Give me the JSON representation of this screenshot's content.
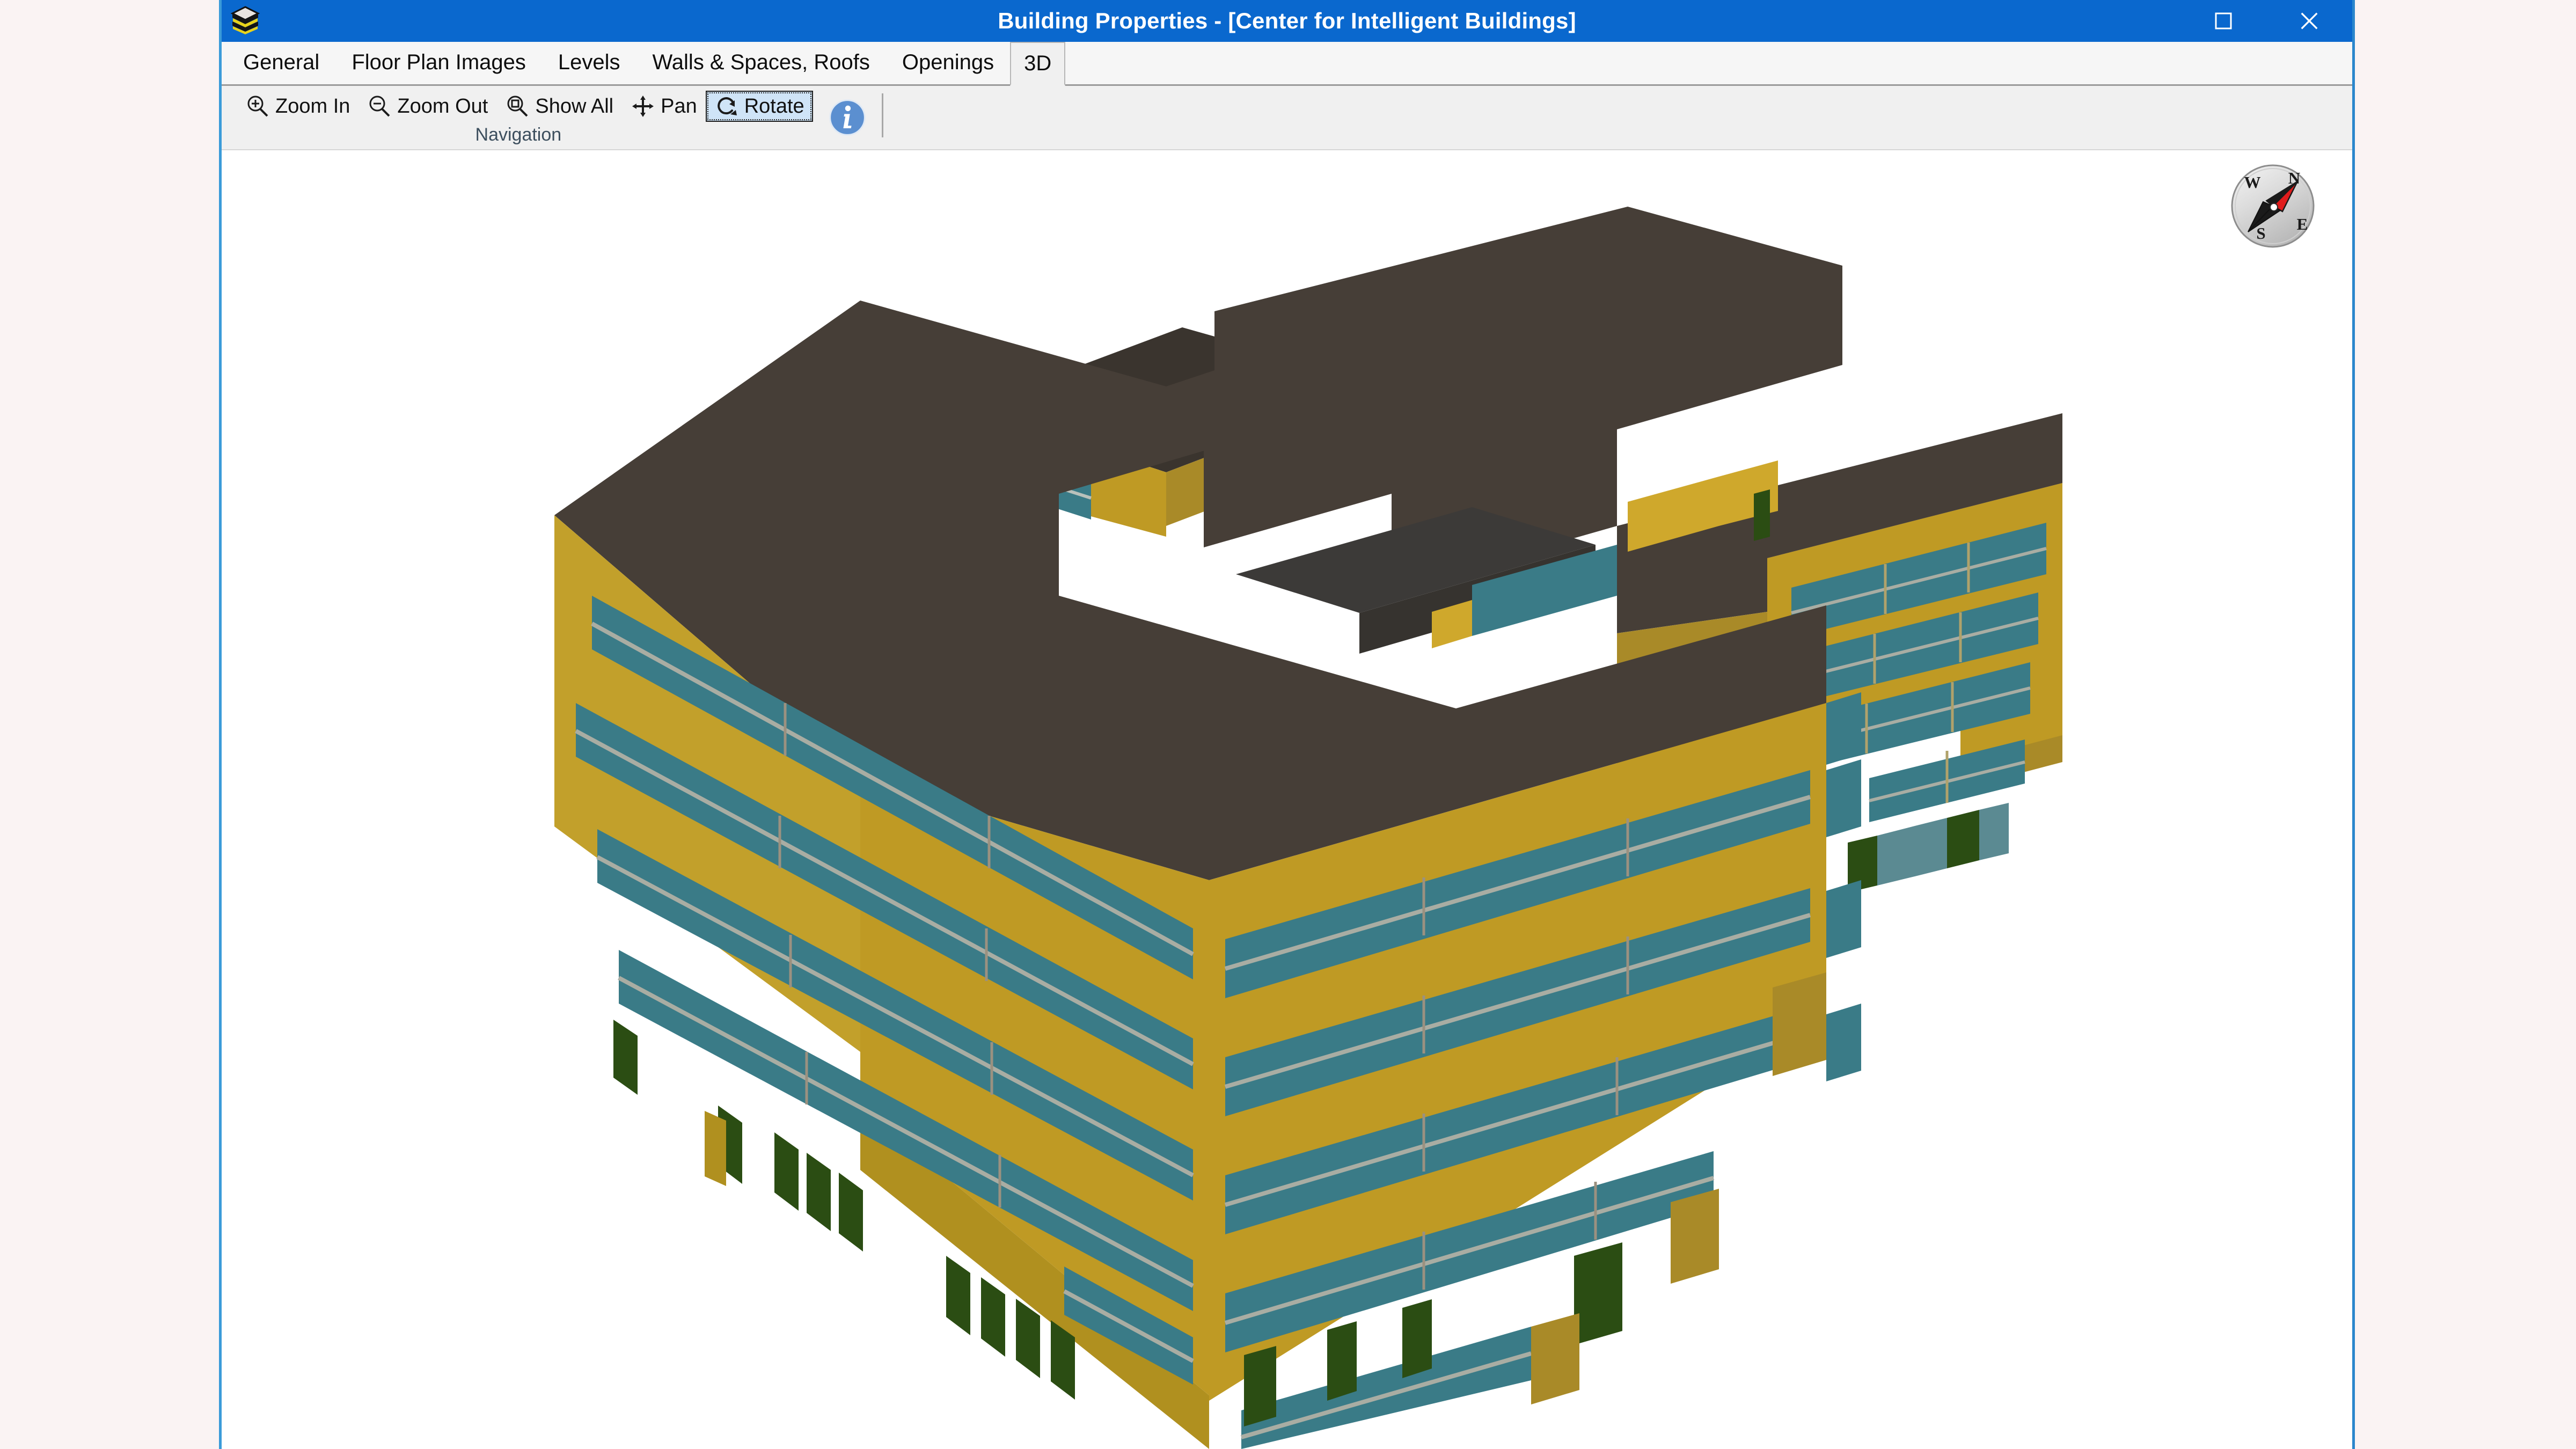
{
  "window": {
    "title": "Building Properties - [Center for Intelligent Buildings]",
    "icon": "layers-stack-icon",
    "controls": [
      {
        "name": "maximize",
        "glyph": "square"
      },
      {
        "name": "close",
        "glyph": "x"
      }
    ]
  },
  "tabs": [
    {
      "id": "general",
      "label": "General",
      "active": false
    },
    {
      "id": "floor-plan-images",
      "label": "Floor Plan Images",
      "active": false
    },
    {
      "id": "levels",
      "label": "Levels",
      "active": false
    },
    {
      "id": "walls-spaces-roofs",
      "label": "Walls & Spaces, Roofs",
      "active": false
    },
    {
      "id": "openings",
      "label": "Openings",
      "active": false
    },
    {
      "id": "3d",
      "label": "3D",
      "active": true
    }
  ],
  "ribbon": {
    "group_caption": "Navigation",
    "items": [
      {
        "id": "zoom-in",
        "label": "Zoom In",
        "icon": "zoom-in-icon",
        "selected": false
      },
      {
        "id": "zoom-out",
        "label": "Zoom Out",
        "icon": "zoom-out-icon",
        "selected": false
      },
      {
        "id": "show-all",
        "label": "Show All",
        "icon": "show-all-icon",
        "selected": false
      },
      {
        "id": "pan",
        "label": "Pan",
        "icon": "pan-icon",
        "selected": false
      },
      {
        "id": "rotate",
        "label": "Rotate",
        "icon": "rotate-icon",
        "selected": true
      }
    ],
    "info_button": {
      "id": "info",
      "icon": "info-icon",
      "label": "i"
    }
  },
  "viewport": {
    "background": "#ffffff",
    "model_name": "Center for Intelligent Buildings",
    "compass": {
      "north": "N",
      "east": "E",
      "south": "S",
      "west": "W",
      "needle_heading": "NE"
    },
    "colors": {
      "wall": "#bf9a24",
      "wall_shaded": "#a98a28",
      "wall_light": "#cfa82c",
      "roof": "#463e37",
      "roof_dark": "#3a342e",
      "roof_recess": "#3c3a38",
      "window": "#3a7b87",
      "window_light": "#4b93a0",
      "mullion": "#a9ada3",
      "door": "#2b4d13",
      "door_dark": "#24410f"
    },
    "building": {
      "stories": 5,
      "window_band_count": 5,
      "wings": [
        "main-curved-block",
        "north-tower",
        "east-wing",
        "east-annex"
      ]
    }
  }
}
